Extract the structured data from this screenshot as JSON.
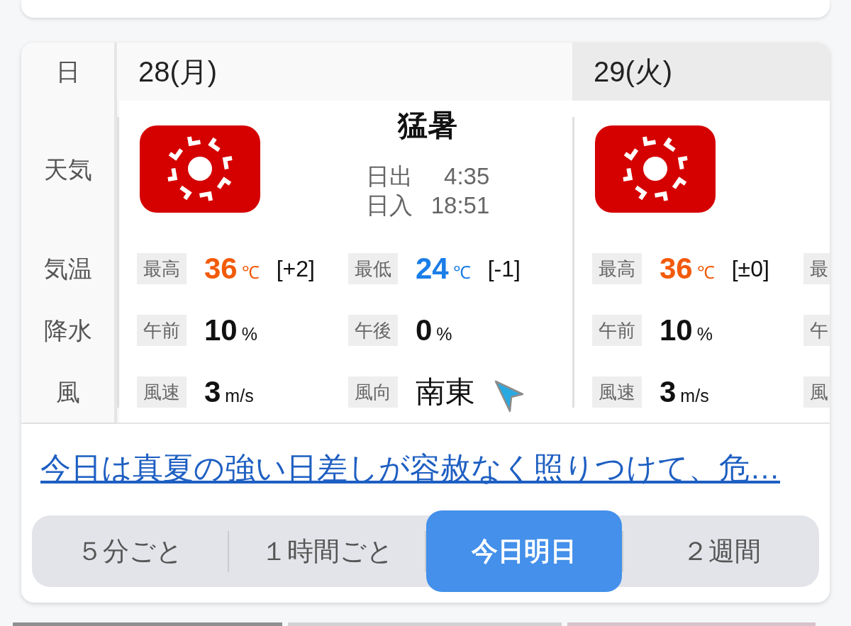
{
  "forecast": {
    "row_header": "日",
    "row_labels": [
      "天気",
      "気温",
      "降水",
      "風"
    ],
    "days": [
      {
        "date": "28(月)",
        "today": true,
        "weather": "猛暑",
        "sun": [
          {
            "label": "日出",
            "time": "4:35"
          },
          {
            "label": "日入",
            "time": "18:51"
          }
        ],
        "temperature": [
          {
            "label": "最高",
            "value": "36",
            "unit": "℃",
            "diff": "[+2]",
            "kind": "high"
          },
          {
            "label": "最低",
            "value": "24",
            "unit": "℃",
            "diff": "[-1]",
            "kind": "low"
          }
        ],
        "precipitation": [
          {
            "label": "午前",
            "value": "10",
            "unit": "%",
            "kind": "amount"
          },
          {
            "label": "午後",
            "value": "0",
            "unit": "%",
            "kind": "amount"
          }
        ],
        "wind": [
          {
            "label": "風速",
            "value": "3",
            "unit": "m/s",
            "kind": "amount"
          },
          {
            "label": "風向",
            "value": "南東",
            "kind": "direction"
          }
        ]
      },
      {
        "date": "29(火)",
        "today": false,
        "temperature": [
          {
            "label": "最高",
            "value": "36",
            "unit": "℃",
            "diff": "[±0]",
            "kind": "high"
          },
          {
            "label": "最"
          }
        ],
        "precipitation": [
          {
            "label": "午前",
            "value": "10",
            "unit": "%",
            "kind": "amount"
          },
          {
            "label": "午"
          }
        ],
        "wind": [
          {
            "label": "風速",
            "value": "3",
            "unit": "m/s",
            "kind": "amount"
          },
          {
            "label": "風"
          }
        ]
      }
    ]
  },
  "summary_link": "今日は真夏の強い日差しが容赦なく照りつけて、危…",
  "segments": [
    {
      "label": "５分ごと",
      "selected": false
    },
    {
      "label": "１時間ごと",
      "selected": false
    },
    {
      "label": "今日明日",
      "selected": true
    },
    {
      "label": "２週間",
      "selected": false
    }
  ]
}
